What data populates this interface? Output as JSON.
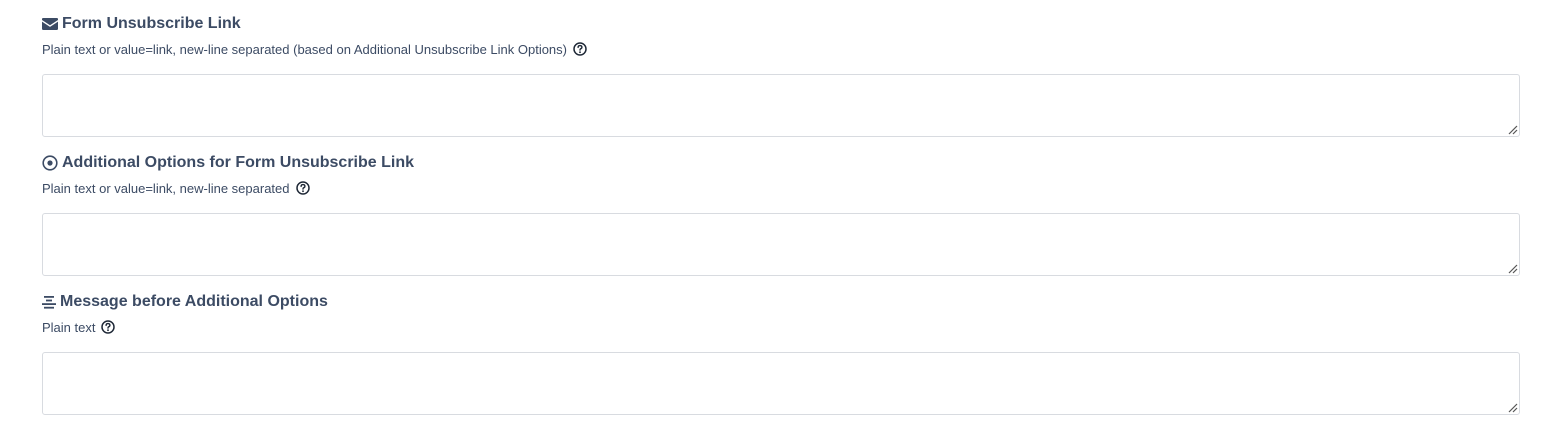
{
  "fields": [
    {
      "title": "Form Unsubscribe Link",
      "icon": "envelope-icon",
      "help": "Plain text or value=link, new-line separated (based on Additional Unsubscribe Link Options)",
      "value": "",
      "placeholder": ""
    },
    {
      "title": "Additional Options for Form Unsubscribe Link",
      "icon": "radio-dot-icon",
      "help": "Plain text or value=link, new-line separated",
      "value": "",
      "placeholder": ""
    },
    {
      "title": "Message before Additional Options",
      "icon": "align-center-icon",
      "help": "Plain text",
      "value": "",
      "placeholder": ""
    }
  ],
  "colors": {
    "text": "#3c4b64",
    "border": "#d8dbe0",
    "background": "#ffffff"
  }
}
